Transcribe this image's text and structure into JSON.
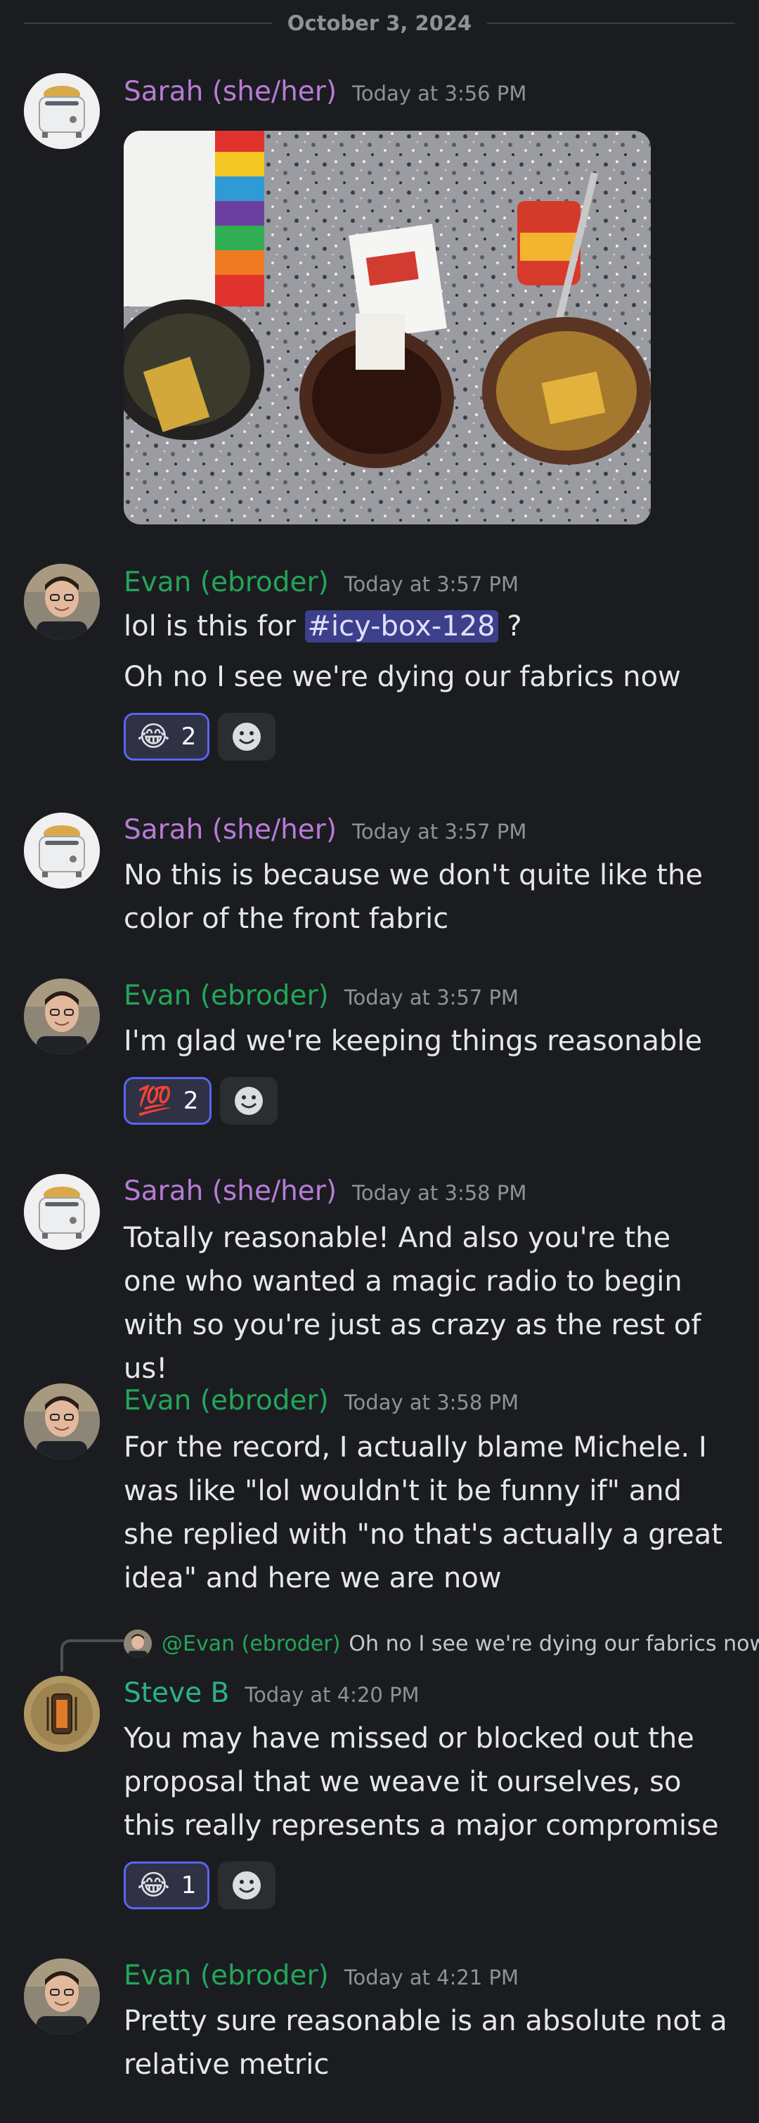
{
  "date_divider": "October 3, 2024",
  "messages": [
    {
      "author": "Sarah (she/her)",
      "timestamp": "Today at 3:56 PM"
    },
    {
      "author": "Evan (ebroder)",
      "timestamp": "Today at 3:57 PM",
      "line1_prefix": "lol is this for ",
      "channel_mention": "#icy-box-128",
      "line1_suffix": " ?",
      "line2": "Oh no I see we're dying our fabrics now",
      "reactions": [
        {
          "emoji": "😂",
          "count": "2"
        }
      ]
    },
    {
      "author": "Sarah (she/her)",
      "timestamp": "Today at 3:57 PM",
      "text": "No this is because we don't quite like the color of the front fabric"
    },
    {
      "author": "Evan (ebroder)",
      "timestamp": "Today at 3:57 PM",
      "text": "I'm glad we're keeping things reasonable",
      "reactions": [
        {
          "emoji": "💯",
          "count": "2"
        }
      ]
    },
    {
      "author": "Sarah (she/her)",
      "timestamp": "Today at 3:58 PM",
      "text": "Totally reasonable! And also you're the one who wanted a magic radio to begin with so you're just as crazy as the rest of us!"
    },
    {
      "author": "Evan (ebroder)",
      "timestamp": "Today at 3:58 PM",
      "text": "For the record, I actually blame Michele. I was like \"lol wouldn't it be funny if\" and she replied with \"no that's actually a great idea\" and here we are now"
    },
    {
      "author": "Steve B",
      "timestamp": "Today at 4:20 PM",
      "reply_mention": "@Evan (ebroder)",
      "reply_text": "Oh no I see we're dying our fabrics now",
      "text": "You may have missed or blocked out the proposal that we weave it ourselves, so this really represents a major compromise",
      "reactions": [
        {
          "emoji": "😂",
          "count": "1"
        }
      ]
    },
    {
      "author": "Evan (ebroder)",
      "timestamp": "Today at 4:21 PM",
      "text": "Pretty sure reasonable is an absolute not a relative metric"
    }
  ],
  "icons": {
    "add_reaction": "smiley-add-icon"
  },
  "colors": {
    "background": "#1b1c20",
    "sarah": "#b77cd6",
    "evan": "#23a55a",
    "steve": "#2ab28a",
    "reaction_border": "#5865f2",
    "channel_mention_bg": "#3c3f8a"
  }
}
